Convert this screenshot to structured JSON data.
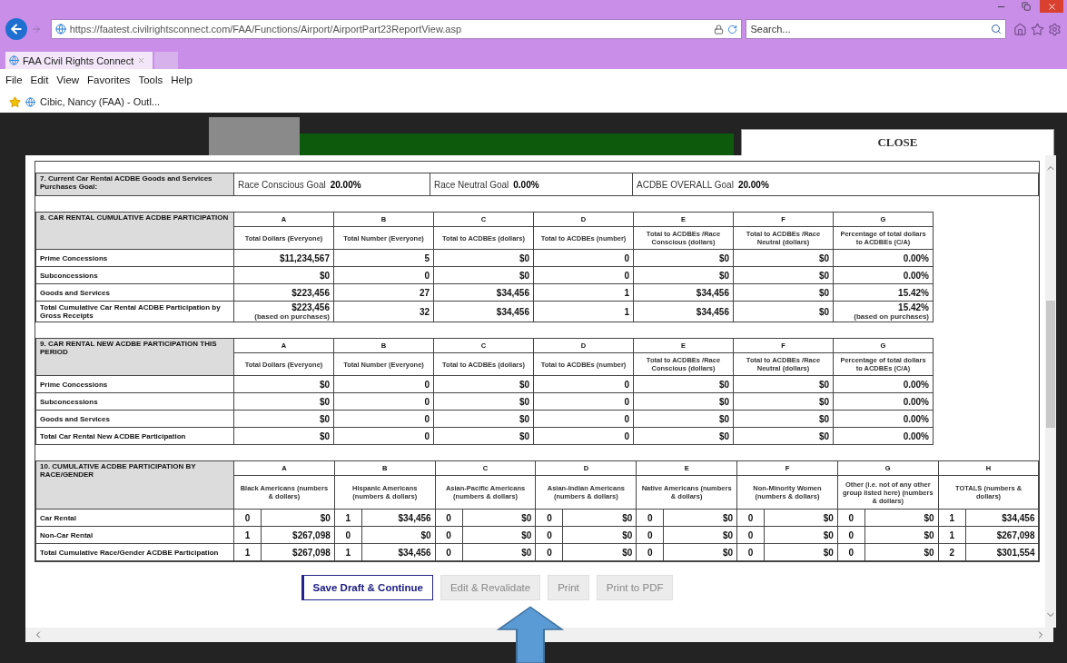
{
  "browser": {
    "address": "https://faatest.civilrightsconnect.com/FAA/Functions/Airport/AirportPart23ReportView.asp",
    "search": {
      "placeholder": "Search..."
    },
    "tabs": [
      {
        "label": "FAA Civil Rights Connect",
        "selected": true
      }
    ],
    "menu": [
      "File",
      "Edit",
      "View",
      "Favorites",
      "Tools",
      "Help"
    ],
    "favorites": [
      "Cibic, Nancy (FAA) - Outl..."
    ]
  },
  "modal": {
    "close": "CLOSE"
  },
  "goal": {
    "title": "7. Current Car Rental ACDBE Goods and Services Purchases Goal:",
    "items": [
      {
        "label": "Race Conscious Goal",
        "value": "20.00%"
      },
      {
        "label": "Race Neutral Goal",
        "value": "0.00%"
      },
      {
        "label": "ACDBE OVERALL Goal",
        "value": "20.00%"
      }
    ]
  },
  "sections": [
    {
      "title": "8. CAR RENTAL CUMULATIVE ACDBE PARTICIPATION",
      "columns": [
        {
          "letter": "A",
          "label": "Total Dollars (Everyone)"
        },
        {
          "letter": "B",
          "label": "Total Number (Everyone)"
        },
        {
          "letter": "C",
          "label": "Total to ACDBEs (dollars)"
        },
        {
          "letter": "D",
          "label": "Total to ACDBEs (number)"
        },
        {
          "letter": "E",
          "label": "Total to ACDBEs /Race Conscious (dollars)"
        },
        {
          "letter": "F",
          "label": "Total to ACDBEs /Race Neutral (dollars)"
        },
        {
          "letter": "G",
          "label": "Percentage of total dollars to ACDBEs (C/A)"
        }
      ],
      "rows": [
        {
          "label": "Prime Concessions",
          "cells": [
            {
              "value": "$11,234,567"
            },
            {
              "value": "5"
            },
            {
              "value": "$0"
            },
            {
              "value": "0"
            },
            {
              "value": "$0"
            },
            {
              "value": "$0"
            },
            {
              "value": "0.00%"
            }
          ]
        },
        {
          "label": "Subconcessions",
          "cells": [
            {
              "value": "$0"
            },
            {
              "value": "0"
            },
            {
              "value": "$0"
            },
            {
              "value": "0"
            },
            {
              "value": "$0"
            },
            {
              "value": "$0"
            },
            {
              "value": "0.00%"
            }
          ]
        },
        {
          "label": "Goods and Services",
          "cells": [
            {
              "value": "$223,456"
            },
            {
              "value": "27"
            },
            {
              "value": "$34,456"
            },
            {
              "value": "1"
            },
            {
              "value": "$34,456"
            },
            {
              "value": "$0"
            },
            {
              "value": "15.42%"
            }
          ]
        },
        {
          "label": "Total Cumulative Car Rental ACDBE Participation by Gross Receipts",
          "cells": [
            {
              "value": "$223,456",
              "note": "(based on purchases)"
            },
            {
              "value": "32"
            },
            {
              "value": "$34,456"
            },
            {
              "value": "1"
            },
            {
              "value": "$34,456"
            },
            {
              "value": "$0"
            },
            {
              "value": "15.42%",
              "note": "(based on purchases)"
            }
          ]
        }
      ]
    },
    {
      "title": "9. CAR RENTAL NEW ACDBE PARTICIPATION THIS PERIOD",
      "columns": [
        {
          "letter": "A",
          "label": "Total Dollars (Everyone)"
        },
        {
          "letter": "B",
          "label": "Total Number (Everyone)"
        },
        {
          "letter": "C",
          "label": "Total to ACDBEs (dollars)"
        },
        {
          "letter": "D",
          "label": "Total to ACDBEs (number)"
        },
        {
          "letter": "E",
          "label": "Total to ACDBEs /Race Conscious (dollars)"
        },
        {
          "letter": "F",
          "label": "Total to ACDBEs /Race Neutral (dollars)"
        },
        {
          "letter": "G",
          "label": "Percentage of total dollars to ACDBEs (C/A)"
        }
      ],
      "rows": [
        {
          "label": "Prime Concessions",
          "cells": [
            {
              "value": "$0"
            },
            {
              "value": "0"
            },
            {
              "value": "$0"
            },
            {
              "value": "0"
            },
            {
              "value": "$0"
            },
            {
              "value": "$0"
            },
            {
              "value": "0.00%"
            }
          ]
        },
        {
          "label": "Subconcessions",
          "cells": [
            {
              "value": "$0"
            },
            {
              "value": "0"
            },
            {
              "value": "$0"
            },
            {
              "value": "0"
            },
            {
              "value": "$0"
            },
            {
              "value": "$0"
            },
            {
              "value": "0.00%"
            }
          ]
        },
        {
          "label": "Goods and Services",
          "cells": [
            {
              "value": "$0"
            },
            {
              "value": "0"
            },
            {
              "value": "$0"
            },
            {
              "value": "0"
            },
            {
              "value": "$0"
            },
            {
              "value": "$0"
            },
            {
              "value": "0.00%"
            }
          ]
        },
        {
          "label": "Total Car Rental New ACDBE Participation",
          "cells": [
            {
              "value": "$0"
            },
            {
              "value": "0"
            },
            {
              "value": "$0"
            },
            {
              "value": "0"
            },
            {
              "value": "$0"
            },
            {
              "value": "$0"
            },
            {
              "value": "0.00%"
            }
          ]
        }
      ]
    }
  ],
  "race_section": {
    "title": "10. CUMULATIVE ACDBE PARTICIPATION BY RACE/GENDER",
    "columns": [
      {
        "letter": "A",
        "label": "Black Americans (numbers & dollars)"
      },
      {
        "letter": "B",
        "label": "Hispanic Americans (numbers & dollars)"
      },
      {
        "letter": "C",
        "label": "Asian-Pacific Americans (numbers & dollars)"
      },
      {
        "letter": "D",
        "label": "Asian-Indian Americans (numbers & dollars)"
      },
      {
        "letter": "E",
        "label": "Native Americans (numbers & dollars)"
      },
      {
        "letter": "F",
        "label": "Non-Minority Women (numbers & dollars)"
      },
      {
        "letter": "G",
        "label": "Other (i.e. not of any other group listed here) (numbers & dollars)"
      },
      {
        "letter": "H",
        "label": "TOTALS (numbers & dollars)"
      }
    ],
    "rows": [
      {
        "label": "Car Rental",
        "cells": [
          {
            "count": "0",
            "amount": "$0"
          },
          {
            "count": "1",
            "amount": "$34,456"
          },
          {
            "count": "0",
            "amount": "$0"
          },
          {
            "count": "0",
            "amount": "$0"
          },
          {
            "count": "0",
            "amount": "$0"
          },
          {
            "count": "0",
            "amount": "$0"
          },
          {
            "count": "0",
            "amount": "$0"
          },
          {
            "count": "1",
            "amount": "$34,456"
          }
        ]
      },
      {
        "label": "Non-Car Rental",
        "cells": [
          {
            "count": "1",
            "amount": "$267,098"
          },
          {
            "count": "0",
            "amount": "$0"
          },
          {
            "count": "0",
            "amount": "$0"
          },
          {
            "count": "0",
            "amount": "$0"
          },
          {
            "count": "0",
            "amount": "$0"
          },
          {
            "count": "0",
            "amount": "$0"
          },
          {
            "count": "0",
            "amount": "$0"
          },
          {
            "count": "1",
            "amount": "$267,098"
          }
        ]
      },
      {
        "label": "Total Cumulative Race/Gender ACDBE Participation",
        "cells": [
          {
            "count": "1",
            "amount": "$267,098"
          },
          {
            "count": "1",
            "amount": "$34,456"
          },
          {
            "count": "0",
            "amount": "$0"
          },
          {
            "count": "0",
            "amount": "$0"
          },
          {
            "count": "0",
            "amount": "$0"
          },
          {
            "count": "0",
            "amount": "$0"
          },
          {
            "count": "0",
            "amount": "$0"
          },
          {
            "count": "2",
            "amount": "$301,554"
          }
        ]
      }
    ]
  },
  "buttons": [
    {
      "label": "Save Draft & Continue",
      "disabled": false
    },
    {
      "label": "Edit & Revalidate",
      "disabled": true
    },
    {
      "label": "Print",
      "disabled": true
    },
    {
      "label": "Print to PDF",
      "disabled": true
    }
  ]
}
